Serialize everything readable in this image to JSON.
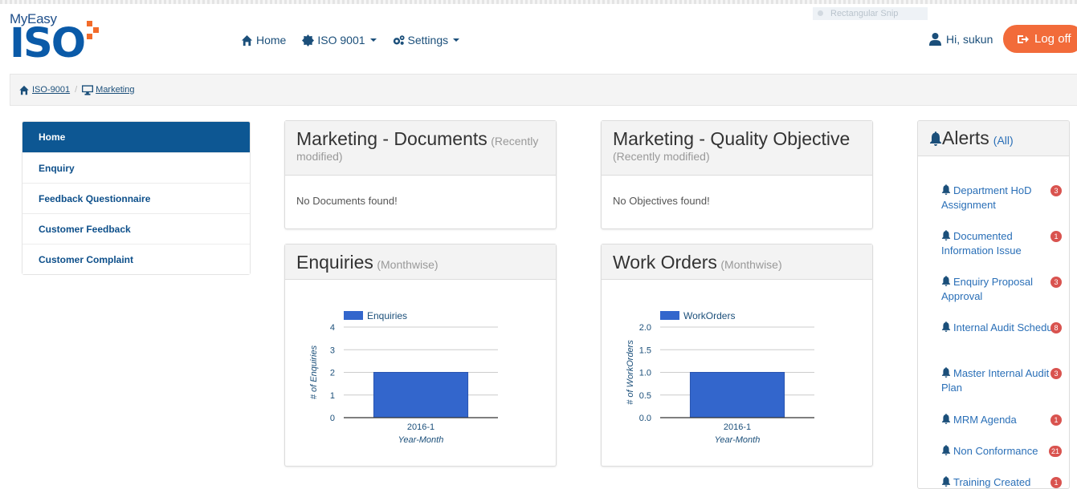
{
  "logo": {
    "top_text": "MyEasy",
    "main_text": "ISO"
  },
  "snip": {
    "label": "Rectangular Snip"
  },
  "nav": {
    "home": "Home",
    "iso": "ISO 9001",
    "settings": "Settings"
  },
  "user": {
    "greeting": "Hi, sukun",
    "logoff": "Log off"
  },
  "breadcrumb": {
    "items": [
      "ISO-9001",
      "Marketing"
    ]
  },
  "sidebar": {
    "items": [
      "Home",
      "Enquiry",
      "Feedback Questionnaire",
      "Customer Feedback",
      "Customer Complaint"
    ],
    "active_index": 0
  },
  "panels": {
    "documents": {
      "title": "Marketing - Documents",
      "subtitle": "(Recently modified)",
      "empty": "No Documents found!"
    },
    "objectives": {
      "title": "Marketing - Quality Objective",
      "subtitle": "(Recently modified)",
      "empty": "No Objectives found!"
    },
    "enquiries": {
      "title": "Enquiries",
      "subtitle": "(Monthwise)"
    },
    "workorders": {
      "title": "Work Orders",
      "subtitle": "(Monthwise)"
    }
  },
  "alerts": {
    "title": "Alerts",
    "all": "(All)",
    "items": [
      {
        "label": "Department HoD Assignment",
        "count": "3"
      },
      {
        "label": "Documented Information Issue",
        "count": "1"
      },
      {
        "label": "Enquiry Proposal Approval",
        "count": "3"
      },
      {
        "label": "Internal Audit Schedule",
        "count": "8"
      },
      {
        "label": "Master Internal Audit Plan",
        "count": "3"
      },
      {
        "label": "MRM Agenda",
        "count": "1"
      },
      {
        "label": "Non Conformance",
        "count": "21"
      },
      {
        "label": "Training Created",
        "count": "1"
      }
    ]
  },
  "colors": {
    "primary": "#0d5793",
    "accent": "#f26b3a",
    "bar": "#3366cc",
    "badge": "#d9534f"
  },
  "chart_data": [
    {
      "type": "bar",
      "title": "",
      "categories": [
        "2016-1"
      ],
      "series": [
        {
          "name": "Enquiries",
          "values": [
            2
          ]
        }
      ],
      "xlabel": "Year-Month",
      "ylabel": "# of Enquiries",
      "ylim": [
        0,
        4
      ],
      "yticks": [
        "0",
        "1",
        "2",
        "3",
        "4"
      ],
      "grid": true,
      "legend": "top"
    },
    {
      "type": "bar",
      "title": "",
      "categories": [
        "2016-1"
      ],
      "series": [
        {
          "name": "WorkOrders",
          "values": [
            1.0
          ]
        }
      ],
      "xlabel": "Year-Month",
      "ylabel": "# of WorkOrders",
      "ylim": [
        0,
        2
      ],
      "yticks": [
        "0.0",
        "0.5",
        "1.0",
        "1.5",
        "2.0"
      ],
      "grid": true,
      "legend": "top"
    }
  ]
}
